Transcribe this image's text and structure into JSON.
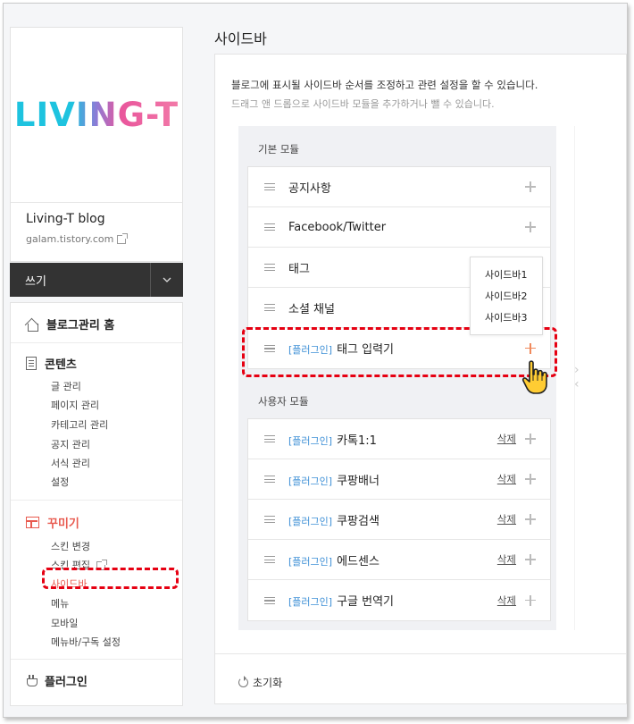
{
  "sidebar": {
    "logo": "LIVING-T",
    "blog_name": "Living-T blog",
    "blog_url": "galam.tistory.com",
    "write_label": "쓰기",
    "sections": {
      "home": "블로그관리 홈",
      "contents": {
        "title": "콘텐츠",
        "items": [
          "글 관리",
          "페이지 관리",
          "카테고리 관리",
          "공지 관리",
          "서식 관리",
          "설정"
        ]
      },
      "decorate": {
        "title": "꾸미기",
        "items": [
          "스킨 변경",
          "스킨 편집",
          "사이드바",
          "메뉴",
          "모바일",
          "메뉴바/구독 설정"
        ]
      },
      "plugin": "플러그인"
    }
  },
  "main": {
    "title": "사이드바",
    "description": "블로그에 표시될 사이드바 순서를 조정하고 관련 설정을 할 수 있습니다.",
    "hint": "드래그 앤 드롭으로 사이드바 모듈을 추가하거나 뺄 수 있습니다.",
    "basic_modules": {
      "label": "기본 모듈",
      "items": [
        {
          "name": "공지사항"
        },
        {
          "name": "Facebook/Twitter"
        },
        {
          "name": "태그"
        },
        {
          "name": "소셜 채널"
        },
        {
          "tag": "[플러그인]",
          "name": "태그 입력기"
        }
      ]
    },
    "user_modules": {
      "label": "사용자 모듈",
      "delete_label": "삭제",
      "items": [
        {
          "tag": "[플러그인]",
          "name": "카톡1:1"
        },
        {
          "tag": "[플러그인]",
          "name": "쿠팡배너"
        },
        {
          "tag": "[플러그인]",
          "name": "쿠팡검색"
        },
        {
          "tag": "[플러그인]",
          "name": "에드센스"
        },
        {
          "tag": "[플러그인]",
          "name": "구글 번역기"
        }
      ]
    },
    "dropdown": [
      "사이드바1",
      "사이드바2",
      "사이드바3"
    ],
    "reset_label": "초기화"
  },
  "colors": {
    "accent": "#e85a4f",
    "plugin_tag": "#3d8fd6",
    "highlight": "#e60012"
  }
}
